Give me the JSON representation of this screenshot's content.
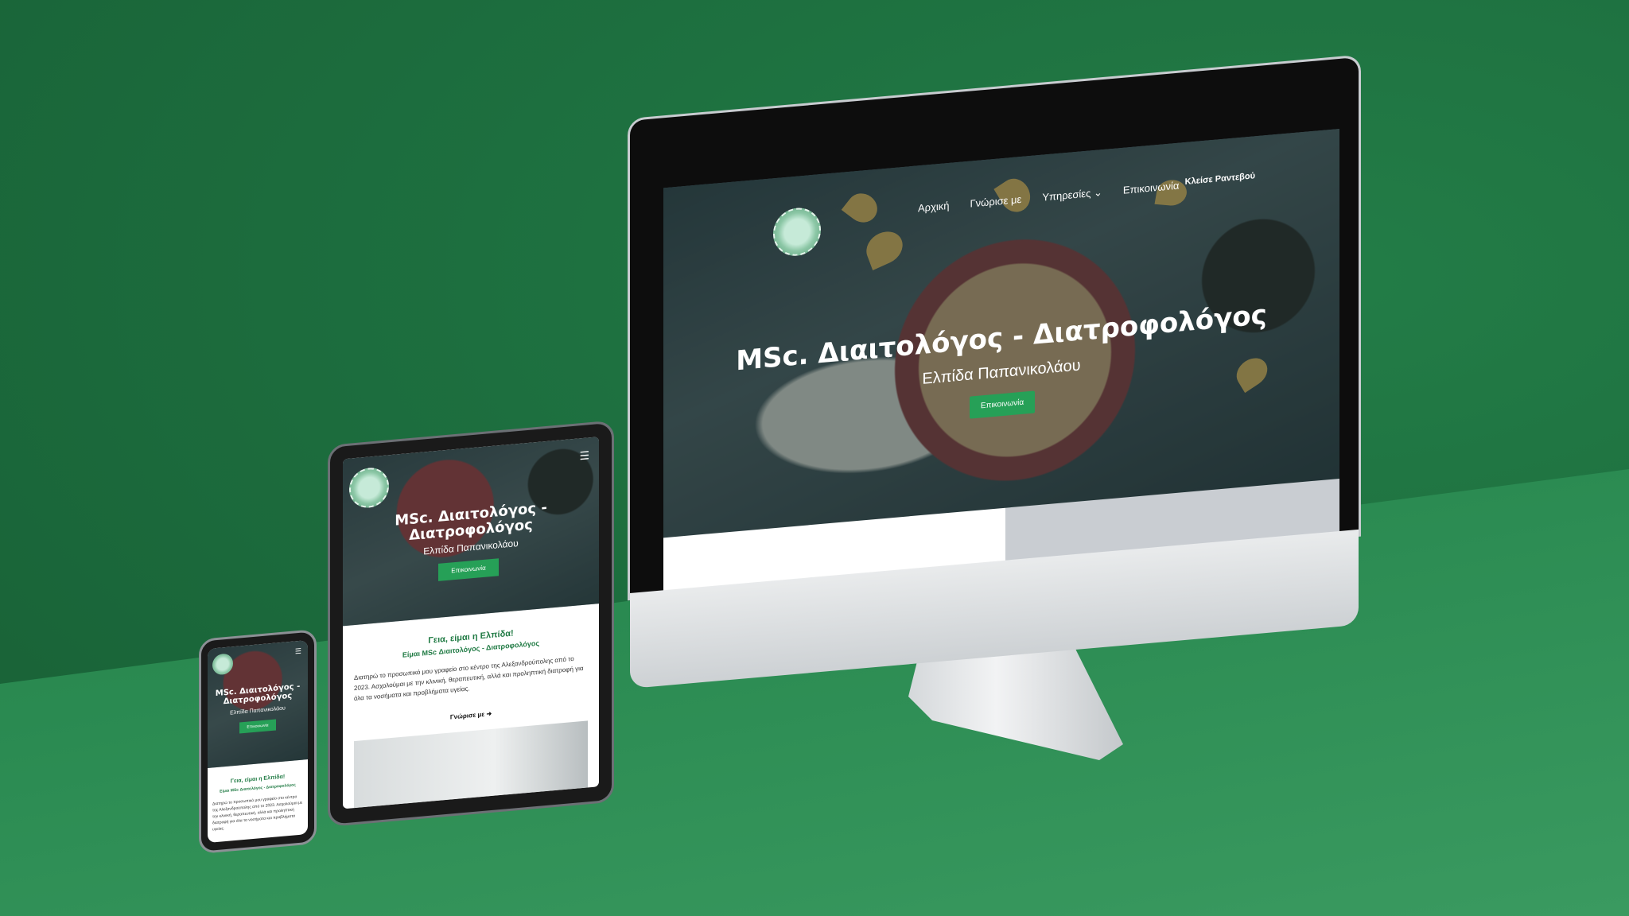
{
  "scene": {
    "wall_color": "#1d6e3e",
    "floor_color": "#2a8a51",
    "accent_green": "#26a057"
  },
  "site": {
    "nav": [
      "Αρχική",
      "Γνώρισε με",
      "Υπηρεσίες",
      "Επικοινωνία"
    ],
    "nav_dropdown_icon": "chevron-down-icon",
    "nav_cta": "Κλείσε Ραντεβού",
    "hero_title": "MSc. Διαιτολόγος - Διατροφολόγος",
    "hero_title_line1": "MSc. Διαιτολόγος -",
    "hero_title_line2": "Διατροφολόγος",
    "hero_subtitle": "Ελπίδα Παπανικολάου",
    "hero_button": "Επικοινωνία",
    "intro_heading": "Γεια, είμαι η Ελπίδα!",
    "intro_subheading": "Είμαι MSc Διαιτολόγος - Διατροφολόγος",
    "intro_text": "Διατηρώ το προσωπικό μου γραφείο στο κέντρο της Αλεξανδρούπολης από το 2023. Ασχολούμαι με την κλινική, θεραπευτική, αλλά και προληπτική διατροφή για όλα τα νοσήματα και προβλήματα υγείας.",
    "intro_link": "Γνώρισε με"
  },
  "devices": {
    "desktop_logo_icon": "apple-logo-icon",
    "menu_icon": "hamburger-menu-icon"
  }
}
